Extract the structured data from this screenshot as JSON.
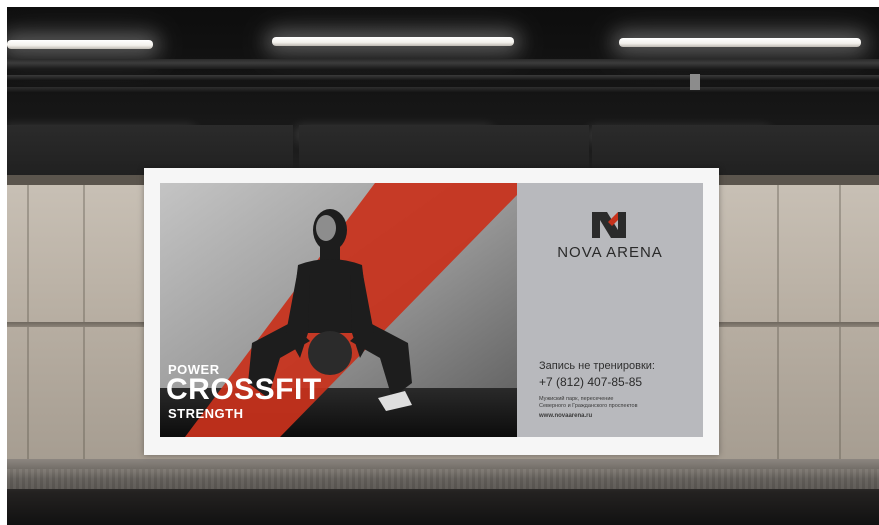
{
  "scene": "subway-platform",
  "billboard": {
    "headline": {
      "line1": "POWER",
      "line2": "CROSSFIT",
      "line3": "STRENGTH"
    },
    "brand": {
      "name": "NOVA ARENA",
      "logo_icon": "nova-arena-logo-icon"
    },
    "contact": {
      "cta": "Запись не тренировки:",
      "phone": "+7 (812) 407-85-85",
      "address_line1": "Мужиский парк, пересечение",
      "address_line2": "Северного и Гражданского проспектов",
      "website": "www.novaarena.ru"
    },
    "colors": {
      "accent_red": "#c8321c",
      "panel_gray": "#b8b9bd"
    }
  }
}
